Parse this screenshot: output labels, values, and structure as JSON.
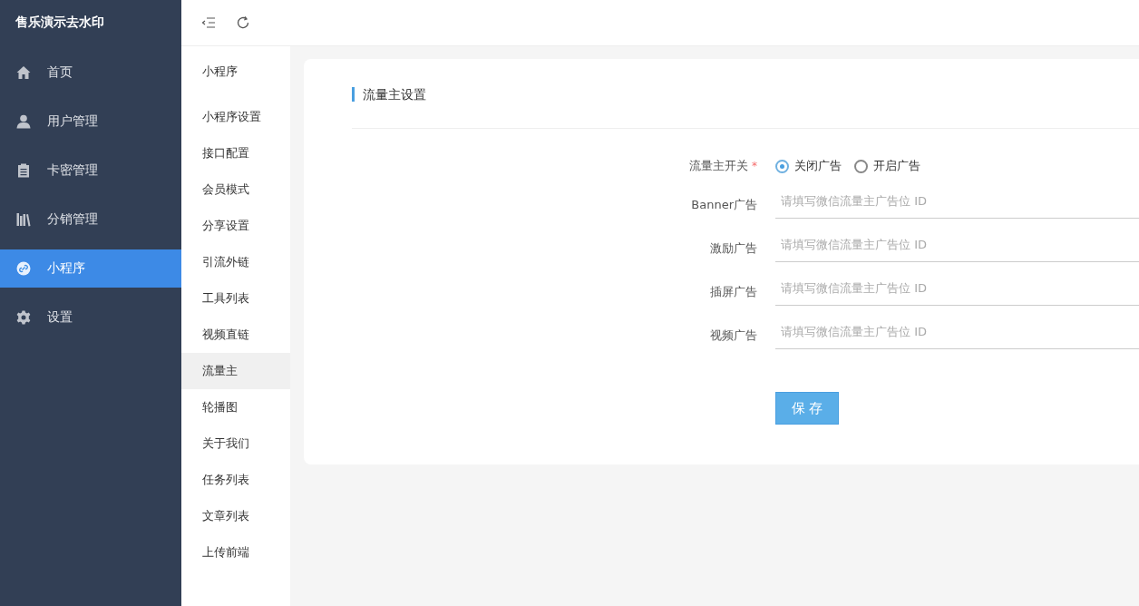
{
  "sidebar": {
    "logo": "售乐演示去水印",
    "items": [
      {
        "label": "首页",
        "selected": false
      },
      {
        "label": "用户管理",
        "selected": false
      },
      {
        "label": "卡密管理",
        "selected": false
      },
      {
        "label": "分销管理",
        "selected": false
      },
      {
        "label": "小程序",
        "selected": true
      },
      {
        "label": "设置",
        "selected": false
      }
    ]
  },
  "submenu": {
    "title": "小程序",
    "items": [
      {
        "label": "小程序设置",
        "selected": false
      },
      {
        "label": "接口配置",
        "selected": false
      },
      {
        "label": "会员模式",
        "selected": false
      },
      {
        "label": "分享设置",
        "selected": false
      },
      {
        "label": "引流外链",
        "selected": false
      },
      {
        "label": "工具列表",
        "selected": false
      },
      {
        "label": "视频直链",
        "selected": false
      },
      {
        "label": "流量主",
        "selected": true
      },
      {
        "label": "轮播图",
        "selected": false
      },
      {
        "label": "关于我们",
        "selected": false
      },
      {
        "label": "任务列表",
        "selected": false
      },
      {
        "label": "文章列表",
        "selected": false
      },
      {
        "label": "上传前端",
        "selected": false
      }
    ]
  },
  "card": {
    "title": "流量主设置",
    "form": [
      {
        "kind": "radio",
        "label": "流量主开关",
        "required_mark": "*",
        "options": [
          {
            "label": "关闭广告",
            "selected": true
          },
          {
            "label": "开启广告",
            "selected": false
          }
        ]
      },
      {
        "kind": "input",
        "label": "Banner广告",
        "placeholder": "请填写微信流量主广告位 ID"
      },
      {
        "kind": "input",
        "label": "激励广告",
        "placeholder": "请填写微信流量主广告位 ID"
      },
      {
        "kind": "input",
        "label": "插屏广告",
        "placeholder": "请填写微信流量主广告位 ID"
      },
      {
        "kind": "input",
        "label": "视频广告",
        "placeholder": "请填写微信流量主广告位 ID"
      }
    ],
    "save_button": "保 存"
  }
}
